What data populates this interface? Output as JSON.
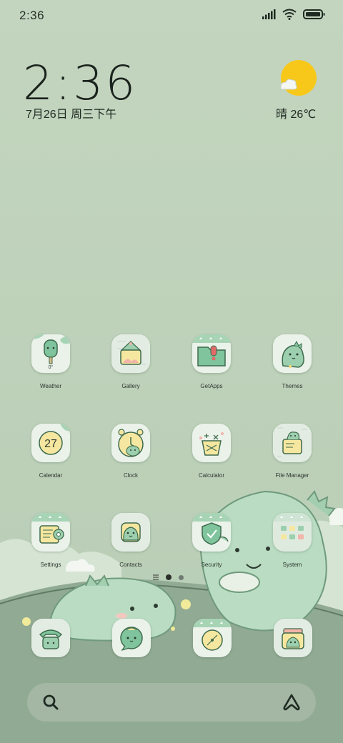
{
  "status_bar": {
    "time": "2:36",
    "icons": [
      "signal-icon",
      "wifi-icon",
      "battery-icon"
    ]
  },
  "clock_widget": {
    "time": "2:36",
    "date": "7月26日 周三下午"
  },
  "weather_widget": {
    "icon": "sun-cloud-icon",
    "text": "晴 26℃"
  },
  "apps": [
    {
      "label": "Weather",
      "icon": "popsicle-icon",
      "sub": "0°"
    },
    {
      "label": "Gallery",
      "icon": "picture-frame-icon"
    },
    {
      "label": "GetApps",
      "icon": "folder-alert-icon"
    },
    {
      "label": "Themes",
      "icon": "dinosaur-icon"
    },
    {
      "label": "Calendar",
      "icon": "calendar-27-icon",
      "number": "27"
    },
    {
      "label": "Clock",
      "icon": "alarm-clock-icon"
    },
    {
      "label": "Calculator",
      "icon": "calculator-icon"
    },
    {
      "label": "File Manager",
      "icon": "file-manager-icon"
    },
    {
      "label": "Settings",
      "icon": "settings-gear-icon"
    },
    {
      "label": "Contacts",
      "icon": "contacts-icon"
    },
    {
      "label": "Security",
      "icon": "shield-check-icon"
    },
    {
      "label": "System",
      "icon": "system-folder-icon"
    }
  ],
  "dock": [
    {
      "name": "phone",
      "icon": "phone-icon"
    },
    {
      "name": "messages",
      "icon": "chat-bubble-icon"
    },
    {
      "name": "browser",
      "icon": "compass-icon"
    },
    {
      "name": "camera",
      "icon": "camera-icon"
    }
  ],
  "page_indicator": {
    "pages": 2,
    "active": 0
  },
  "search_bar": {
    "left_icon": "search-icon",
    "right_icon": "assistant-icon"
  },
  "colors": {
    "background": "#c1d3bd",
    "hill": "#8fa891",
    "dino": "#b9dcc2",
    "sun": "#f7c81a",
    "tile": "#eaf2ea",
    "search": "#a3b7a4"
  }
}
